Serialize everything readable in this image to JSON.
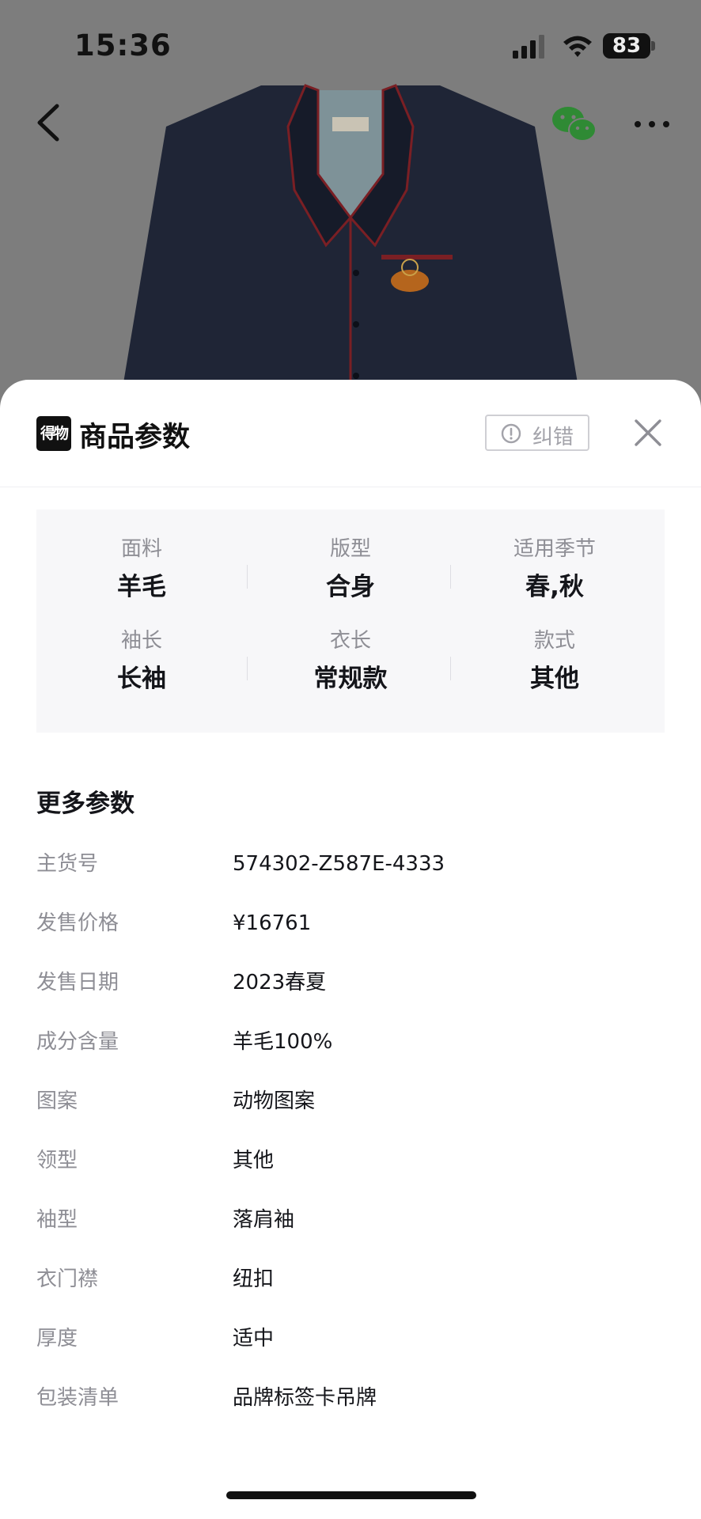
{
  "status_bar": {
    "time": "15:36",
    "battery": "83"
  },
  "nav": {
    "back_icon": "chevron-left-icon",
    "share_icon": "wechat-icon",
    "more_icon": "more-dots-icon"
  },
  "sheet": {
    "logo_text": "得物",
    "title": "商品参数",
    "correct_label": "纠错",
    "key_params": [
      {
        "label": "面料",
        "value": "羊毛"
      },
      {
        "label": "版型",
        "value": "合身"
      },
      {
        "label": "适用季节",
        "value": "春,秋"
      },
      {
        "label": "袖长",
        "value": "长袖"
      },
      {
        "label": "衣长",
        "value": "常规款"
      },
      {
        "label": "款式",
        "value": "其他"
      }
    ],
    "more_title": "更多参数",
    "more_params": [
      {
        "label": "主货号",
        "value": "574302-Z587E-4333"
      },
      {
        "label": "发售价格",
        "value": "¥16761"
      },
      {
        "label": "发售日期",
        "value": "2023春夏"
      },
      {
        "label": "成分含量",
        "value": "羊毛100%"
      },
      {
        "label": "图案",
        "value": "动物图案"
      },
      {
        "label": "领型",
        "value": "其他"
      },
      {
        "label": "袖型",
        "value": "落肩袖"
      },
      {
        "label": "衣门襟",
        "value": "纽扣"
      },
      {
        "label": "厚度",
        "value": "适中"
      },
      {
        "label": "包装清单",
        "value": "品牌标签卡吊牌"
      }
    ]
  },
  "colors": {
    "overlay": "#7d7d7d",
    "jacket": "#1c2233",
    "piping": "#8a1f25",
    "text_primary": "#14151a",
    "text_secondary": "#8e8e95"
  }
}
